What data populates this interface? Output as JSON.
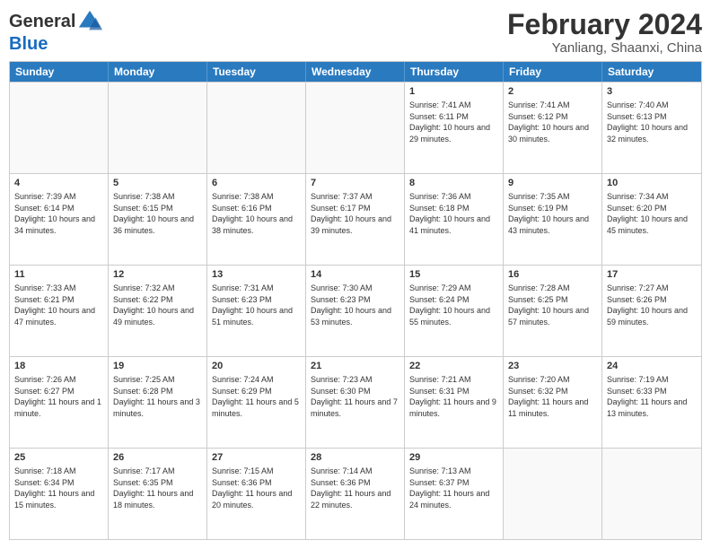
{
  "header": {
    "logo_general": "General",
    "logo_blue": "Blue",
    "month_year": "February 2024",
    "location": "Yanliang, Shaanxi, China"
  },
  "days_of_week": [
    "Sunday",
    "Monday",
    "Tuesday",
    "Wednesday",
    "Thursday",
    "Friday",
    "Saturday"
  ],
  "weeks": [
    [
      {
        "day": "",
        "empty": true
      },
      {
        "day": "",
        "empty": true
      },
      {
        "day": "",
        "empty": true
      },
      {
        "day": "",
        "empty": true
      },
      {
        "day": "1",
        "sunrise": "7:41 AM",
        "sunset": "6:11 PM",
        "daylight": "10 hours and 29 minutes."
      },
      {
        "day": "2",
        "sunrise": "7:41 AM",
        "sunset": "6:12 PM",
        "daylight": "10 hours and 30 minutes."
      },
      {
        "day": "3",
        "sunrise": "7:40 AM",
        "sunset": "6:13 PM",
        "daylight": "10 hours and 32 minutes."
      }
    ],
    [
      {
        "day": "4",
        "sunrise": "7:39 AM",
        "sunset": "6:14 PM",
        "daylight": "10 hours and 34 minutes."
      },
      {
        "day": "5",
        "sunrise": "7:38 AM",
        "sunset": "6:15 PM",
        "daylight": "10 hours and 36 minutes."
      },
      {
        "day": "6",
        "sunrise": "7:38 AM",
        "sunset": "6:16 PM",
        "daylight": "10 hours and 38 minutes."
      },
      {
        "day": "7",
        "sunrise": "7:37 AM",
        "sunset": "6:17 PM",
        "daylight": "10 hours and 39 minutes."
      },
      {
        "day": "8",
        "sunrise": "7:36 AM",
        "sunset": "6:18 PM",
        "daylight": "10 hours and 41 minutes."
      },
      {
        "day": "9",
        "sunrise": "7:35 AM",
        "sunset": "6:19 PM",
        "daylight": "10 hours and 43 minutes."
      },
      {
        "day": "10",
        "sunrise": "7:34 AM",
        "sunset": "6:20 PM",
        "daylight": "10 hours and 45 minutes."
      }
    ],
    [
      {
        "day": "11",
        "sunrise": "7:33 AM",
        "sunset": "6:21 PM",
        "daylight": "10 hours and 47 minutes."
      },
      {
        "day": "12",
        "sunrise": "7:32 AM",
        "sunset": "6:22 PM",
        "daylight": "10 hours and 49 minutes."
      },
      {
        "day": "13",
        "sunrise": "7:31 AM",
        "sunset": "6:23 PM",
        "daylight": "10 hours and 51 minutes."
      },
      {
        "day": "14",
        "sunrise": "7:30 AM",
        "sunset": "6:23 PM",
        "daylight": "10 hours and 53 minutes."
      },
      {
        "day": "15",
        "sunrise": "7:29 AM",
        "sunset": "6:24 PM",
        "daylight": "10 hours and 55 minutes."
      },
      {
        "day": "16",
        "sunrise": "7:28 AM",
        "sunset": "6:25 PM",
        "daylight": "10 hours and 57 minutes."
      },
      {
        "day": "17",
        "sunrise": "7:27 AM",
        "sunset": "6:26 PM",
        "daylight": "10 hours and 59 minutes."
      }
    ],
    [
      {
        "day": "18",
        "sunrise": "7:26 AM",
        "sunset": "6:27 PM",
        "daylight": "11 hours and 1 minute."
      },
      {
        "day": "19",
        "sunrise": "7:25 AM",
        "sunset": "6:28 PM",
        "daylight": "11 hours and 3 minutes."
      },
      {
        "day": "20",
        "sunrise": "7:24 AM",
        "sunset": "6:29 PM",
        "daylight": "11 hours and 5 minutes."
      },
      {
        "day": "21",
        "sunrise": "7:23 AM",
        "sunset": "6:30 PM",
        "daylight": "11 hours and 7 minutes."
      },
      {
        "day": "22",
        "sunrise": "7:21 AM",
        "sunset": "6:31 PM",
        "daylight": "11 hours and 9 minutes."
      },
      {
        "day": "23",
        "sunrise": "7:20 AM",
        "sunset": "6:32 PM",
        "daylight": "11 hours and 11 minutes."
      },
      {
        "day": "24",
        "sunrise": "7:19 AM",
        "sunset": "6:33 PM",
        "daylight": "11 hours and 13 minutes."
      }
    ],
    [
      {
        "day": "25",
        "sunrise": "7:18 AM",
        "sunset": "6:34 PM",
        "daylight": "11 hours and 15 minutes."
      },
      {
        "day": "26",
        "sunrise": "7:17 AM",
        "sunset": "6:35 PM",
        "daylight": "11 hours and 18 minutes."
      },
      {
        "day": "27",
        "sunrise": "7:15 AM",
        "sunset": "6:36 PM",
        "daylight": "11 hours and 20 minutes."
      },
      {
        "day": "28",
        "sunrise": "7:14 AM",
        "sunset": "6:36 PM",
        "daylight": "11 hours and 22 minutes."
      },
      {
        "day": "29",
        "sunrise": "7:13 AM",
        "sunset": "6:37 PM",
        "daylight": "11 hours and 24 minutes."
      },
      {
        "day": "",
        "empty": true
      },
      {
        "day": "",
        "empty": true
      }
    ]
  ]
}
